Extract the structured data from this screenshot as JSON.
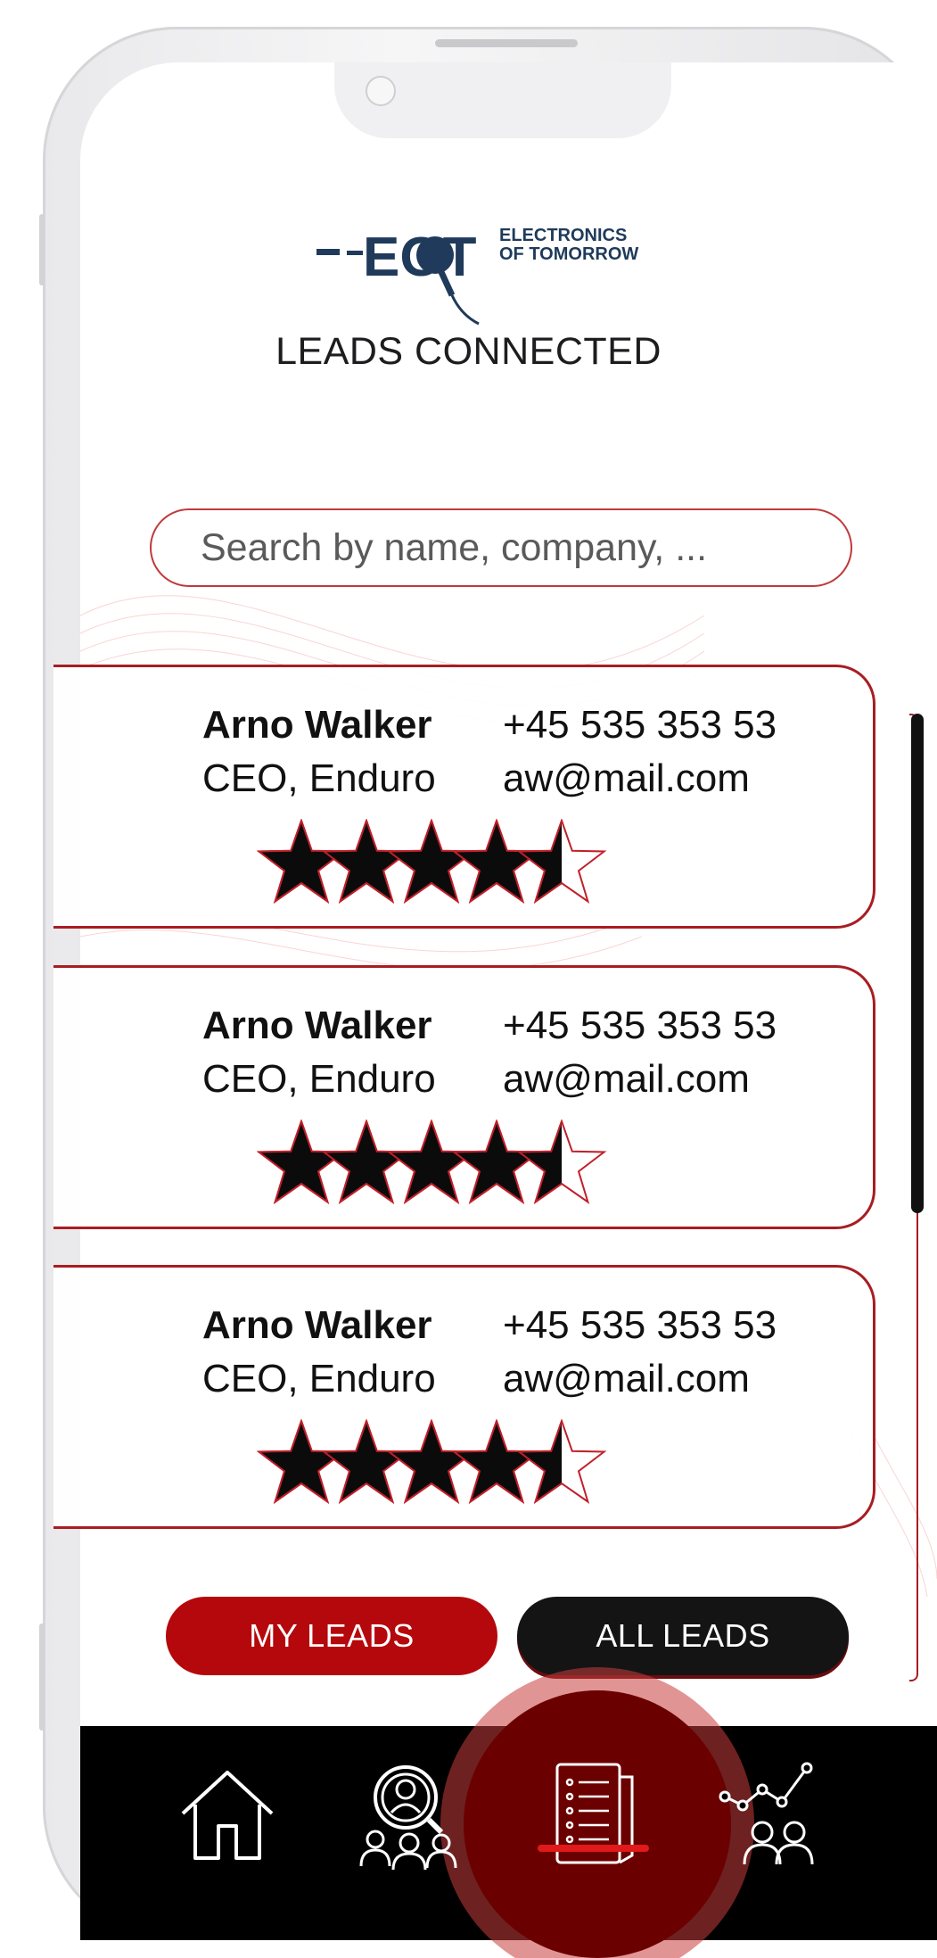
{
  "logo": {
    "brand_letters": "EOT",
    "line1": "ELECTRONICS",
    "line2": "OF TOMORROW"
  },
  "page_title": "LEADS CONNECTED",
  "search": {
    "placeholder": "Search by name, company, ..."
  },
  "leads": [
    {
      "name": "Arno Walker",
      "role": "CEO, Enduro",
      "phone": "+45 535 353 53",
      "email": "aw@mail.com",
      "rating": 4.5
    },
    {
      "name": "Arno Walker",
      "role": "CEO, Enduro",
      "phone": "+45 535 353 53",
      "email": "aw@mail.com",
      "rating": 4.5
    },
    {
      "name": "Arno Walker",
      "role": "CEO, Enduro",
      "phone": "+45 535 353 53",
      "email": "aw@mail.com",
      "rating": 4.5
    }
  ],
  "tabs": {
    "my_leads": "MY LEADS",
    "all_leads": "ALL LEADS"
  },
  "nav": {
    "items": [
      "home-icon",
      "search-people-icon",
      "leads-list-icon",
      "analytics-people-icon"
    ],
    "active_index": 2
  },
  "colors": {
    "accent": "#b5080c",
    "dark": "#141414",
    "logo_blue": "#1f3a5a"
  }
}
